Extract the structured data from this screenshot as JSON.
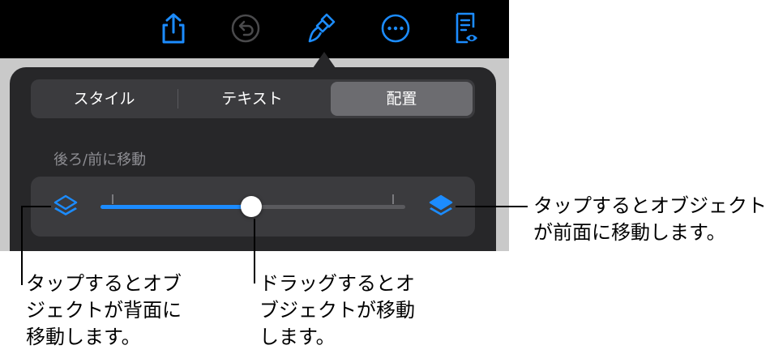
{
  "colors": {
    "accent": "#1c8cff",
    "toolbar_bg": "#000000",
    "popover_bg": "#272729",
    "control_bg": "#3b3b3e",
    "selected_segment": "#6c6c70"
  },
  "toolbar": {
    "icons": [
      "share-icon",
      "undo-icon",
      "format-brush-icon",
      "more-icon",
      "reader-view-icon"
    ]
  },
  "tabs": [
    {
      "label": "スタイル",
      "selected": false
    },
    {
      "label": "テキスト",
      "selected": false
    },
    {
      "label": "配置",
      "selected": true
    }
  ],
  "arrange": {
    "section_label": "後ろ/前に移動",
    "slider_value": 0.5
  },
  "callouts": {
    "back": "タップするとオブ\nジェクトが背面に\n移動します。",
    "slider": "ドラッグするとオ\nブジェクトが移動\nします。",
    "front": "タップするとオブジェクト\nが前面に移動します。"
  }
}
